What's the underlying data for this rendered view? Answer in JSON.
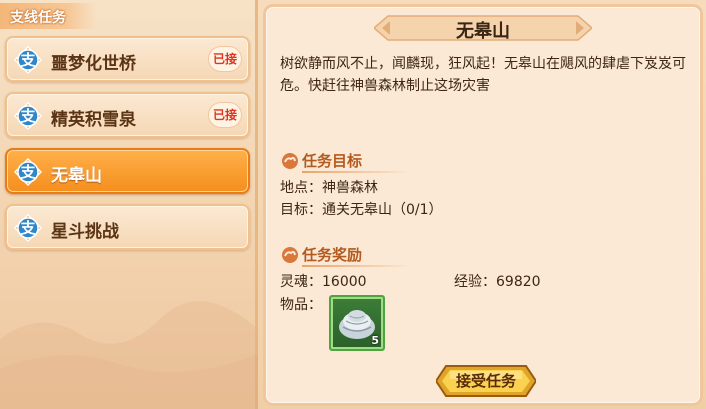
{
  "sidebar": {
    "header": "支线任务",
    "badge_char": "支",
    "items": [
      {
        "label": "噩梦化世桥",
        "status": "已接"
      },
      {
        "label": "精英积雪泉",
        "status": "已接"
      },
      {
        "label": "无皋山",
        "status": ""
      },
      {
        "label": "星斗挑战",
        "status": ""
      }
    ]
  },
  "quest": {
    "title": "无皋山",
    "description": "树欲静而风不止，闻麟现，狂风起！无皋山在飓风的肆虐下岌岌可危。快赶往神兽森林制止这场灾害",
    "objective_title": "任务目标",
    "location_label": "地点：",
    "location_value": "神兽森林",
    "target_label": "目标：",
    "target_value": "通关无皋山（0/1）",
    "reward_title": "任务奖励",
    "soul_label": "灵魂：",
    "soul_value": "16000",
    "exp_label": "经验：",
    "exp_value": "69820",
    "items_label": "物品：",
    "reward_item": {
      "icon": "silver-ore-icon",
      "count": "5"
    },
    "accept_label": "接受任务"
  },
  "colors": {
    "accent_orange": "#f58e1e",
    "status_red": "#e2331f",
    "section_title": "#b55a1e",
    "item_frame_green": "#4fa341"
  }
}
